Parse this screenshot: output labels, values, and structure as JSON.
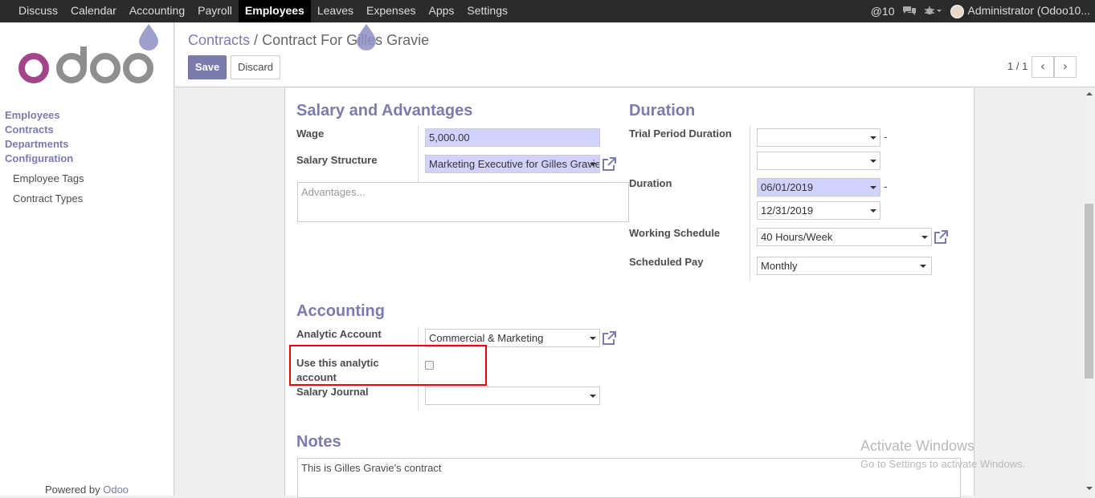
{
  "topbar": {
    "menus": [
      "Discuss",
      "Calendar",
      "Accounting",
      "Payroll",
      "Employees",
      "Leaves",
      "Expenses",
      "Apps",
      "Settings"
    ],
    "active_menu": "Employees",
    "notification_count": "10",
    "user": "Administrator (Odoo10..."
  },
  "sidebar": {
    "items": [
      "Employees",
      "Contracts",
      "Departments",
      "Configuration"
    ],
    "sub_items": [
      "Employee Tags",
      "Contract Types"
    ],
    "powered_by": "Powered by",
    "powered_brand": "Odoo"
  },
  "breadcrumb": {
    "parent": "Contracts",
    "separator": "/",
    "current": "Contract For Gilles Gravie"
  },
  "buttons": {
    "save": "Save",
    "discard": "Discard"
  },
  "pager": {
    "text": "1 / 1"
  },
  "salary": {
    "title": "Salary and Advantages",
    "wage_label": "Wage",
    "wage_value": "5,000.00",
    "structure_label": "Salary Structure",
    "structure_value": "Marketing Executive for Gilles Gravie",
    "advantages_placeholder": "Advantages..."
  },
  "duration": {
    "title": "Duration",
    "trial_label": "Trial Period Duration",
    "trial_start": "",
    "trial_end": "",
    "duration_label": "Duration",
    "start": "06/01/2019",
    "end": "12/31/2019",
    "schedule_label": "Working Schedule",
    "schedule_value": "40 Hours/Week",
    "pay_label": "Scheduled Pay",
    "pay_value": "Monthly"
  },
  "accounting": {
    "title": "Accounting",
    "analytic_label": "Analytic Account",
    "analytic_value": "Commercial & Marketing",
    "use_analytic_label": "Use this analytic account",
    "use_analytic_checked": false,
    "journal_label": "Salary Journal",
    "journal_value": ""
  },
  "notes": {
    "title": "Notes",
    "text": "This is Gilles Gravie's contract"
  },
  "watermark": {
    "line1": "Activate Windows",
    "line2": "Go to Settings to activate Windows."
  },
  "colors": {
    "brand": "#7c7bad",
    "required_field": "#d2d2ff",
    "highlight": "#ee0000"
  }
}
